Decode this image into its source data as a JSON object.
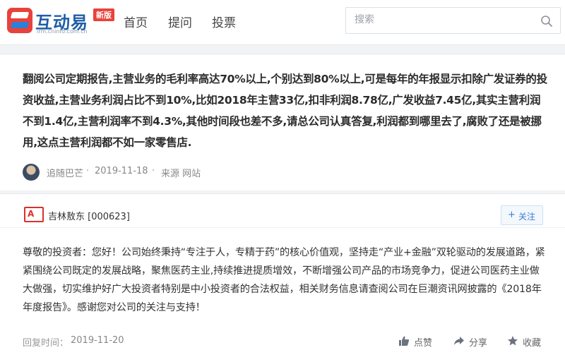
{
  "header": {
    "logo": {
      "title": "互动易",
      "subtitle": "irm.cninfo.com.cn",
      "badge": "新版"
    },
    "nav": [
      {
        "label": "首页"
      },
      {
        "label": "提问"
      },
      {
        "label": "投票"
      }
    ],
    "search": {
      "placeholder": "搜索",
      "value": ""
    }
  },
  "question": {
    "text": "翻阅公司定期报告,主营业务的毛利率高达70%以上,个别达到80%以上,可是每年的年报显示扣除广发证券的投资收益,主营业务利润占比不到10%,比如2018年主营33亿,扣非利润8.78亿,广发收益7.45亿,其实主营利润不到1.4亿,主营利润率不到4.3%,其他时间段也差不多,请总公司认真答复,利润都到哪里去了,腐败了还是被挪用,这点主营利润都不如一家零售店.",
    "user": "追随巴芒",
    "date": "2019-11-18",
    "source": "来源 网站",
    "separator": "·"
  },
  "answer": {
    "company": "吉林敖东 [000623]",
    "follow": {
      "plus": "+",
      "label": "关注"
    },
    "text": "尊敬的投资者：您好！公司始终秉持“专注于人，专精于药”的核心价值观，坚持走“产业+金融”双轮驱动的发展道路，紧紧围绕公司既定的发展战略，聚焦医药主业,持续推进提质增效，不断增强公司产品的市场竞争力，促进公司医药主业做大做强，切实维护好广大投资者特别是中小投资者的合法权益，相关财务信息请查阅公司在巨潮资讯网披露的《2018年年度报告》。感谢您对公司的关注与支持！",
    "reply_label": "回复时间：",
    "reply_date": "2019-11-20",
    "actions": [
      {
        "label": "点赞",
        "icon": "thumbs-up-icon"
      },
      {
        "label": "分享",
        "icon": "share-icon"
      },
      {
        "label": "收藏",
        "icon": "star-icon"
      }
    ]
  },
  "colors": {
    "brand_red": "#e8423b",
    "brand_blue": "#1f5ea8",
    "follow_blue": "#3b7fd1",
    "background": "#f2f3f5"
  }
}
